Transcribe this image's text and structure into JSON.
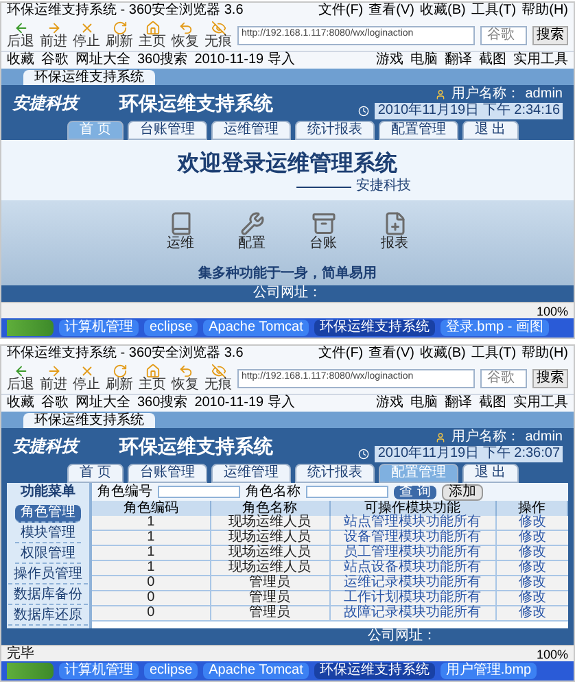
{
  "screens": [
    {
      "browser": {
        "title": "环保运维支持系统 - 360安全浏览器 3.6",
        "menu": [
          "文件(F)",
          "查看(V)",
          "收藏(B)",
          "工具(T)",
          "帮助(H)"
        ],
        "nav": [
          "后退",
          "前进",
          "停止",
          "刷新",
          "主页",
          "恢复",
          "无痕"
        ],
        "url": "http://192.168.1.117:8080/wx/loginaction",
        "search_placeholder": "谷歌",
        "search_button": "搜索",
        "favorites": [
          "收藏",
          "谷歌",
          "网址大全",
          "360搜索",
          "2010-11-19 导入"
        ],
        "tools": [
          "游戏",
          "电脑",
          "翻译",
          "截图",
          "实用工具"
        ],
        "tab": "环保运维支持系统"
      },
      "app": {
        "logo": "安捷科技",
        "title": "环保运维支持系统",
        "user_label": "用户名称：",
        "user": "admin",
        "datetime": "2010年11月19日 下午 2:34:16",
        "tabs": [
          {
            "label": "首 页",
            "selected": true
          },
          {
            "label": "台账管理",
            "selected": false
          },
          {
            "label": "运维管理",
            "selected": false
          },
          {
            "label": "统计报表",
            "selected": false
          },
          {
            "label": "配置管理",
            "selected": false
          },
          {
            "label": "退 出",
            "selected": false
          }
        ]
      },
      "content": {
        "kind": "welcome",
        "heading": "欢迎登录运维管理系统",
        "signature": "安捷科技",
        "modules": [
          "运维",
          "配置",
          "台账",
          "报表"
        ],
        "slogan": "集多种功能于一身，简单易用",
        "footer": "公司网址："
      },
      "status": {
        "zoom": "100%"
      },
      "taskbar": [
        {
          "label": "计算机管理",
          "selected": false
        },
        {
          "label": "eclipse",
          "selected": false
        },
        {
          "label": "Apache Tomcat",
          "selected": false
        },
        {
          "label": "环保运维支持系统",
          "selected": true
        },
        {
          "label": "登录.bmp - 画图",
          "selected": false
        }
      ]
    },
    {
      "browser": {
        "title": "环保运维支持系统 - 360安全浏览器 3.6",
        "menu": [
          "文件(F)",
          "查看(V)",
          "收藏(B)",
          "工具(T)",
          "帮助(H)"
        ],
        "nav": [
          "后退",
          "前进",
          "停止",
          "刷新",
          "主页",
          "恢复",
          "无痕"
        ],
        "url": "http://192.168.1.117:8080/wx/loginaction",
        "search_placeholder": "谷歌",
        "search_button": "搜索",
        "favorites": [
          "收藏",
          "谷歌",
          "网址大全",
          "360搜索",
          "2010-11-19 导入"
        ],
        "tools": [
          "游戏",
          "电脑",
          "翻译",
          "截图",
          "实用工具"
        ],
        "tab": "环保运维支持系统"
      },
      "app": {
        "logo": "安捷科技",
        "title": "环保运维支持系统",
        "user_label": "用户名称：",
        "user": "admin",
        "datetime": "2010年11月19日 下午 2:36:07",
        "tabs": [
          {
            "label": "首 页",
            "selected": false
          },
          {
            "label": "台账管理",
            "selected": false
          },
          {
            "label": "运维管理",
            "selected": false
          },
          {
            "label": "统计报表",
            "selected": false
          },
          {
            "label": "配置管理",
            "selected": true
          },
          {
            "label": "退 出",
            "selected": false
          }
        ]
      },
      "content": {
        "kind": "table",
        "menu_title": "功能菜单",
        "menu": [
          {
            "label": "角色管理",
            "selected": true
          },
          {
            "label": "模块管理",
            "selected": false
          },
          {
            "label": "权限管理",
            "selected": false
          },
          {
            "label": "操作员管理",
            "selected": false
          },
          {
            "label": "数据库备份",
            "selected": false
          },
          {
            "label": "数据库还原",
            "selected": false
          }
        ],
        "filters": [
          "角色编号",
          "角色名称"
        ],
        "search_button": "查 询",
        "add_button": "添加",
        "columns": [
          "角色编码",
          "角色名称",
          "可操作模块功能",
          "操作"
        ],
        "rows": [
          [
            "1",
            "现场运维人员",
            "站点管理模块功能所有",
            "修改"
          ],
          [
            "1",
            "现场运维人员",
            "设备管理模块功能所有",
            "修改"
          ],
          [
            "1",
            "现场运维人员",
            "员工管理模块功能所有",
            "修改"
          ],
          [
            "1",
            "现场运维人员",
            "站点设备模块功能所有",
            "修改"
          ],
          [
            "0",
            "管理员",
            "运维记录模块功能所有",
            "修改"
          ],
          [
            "0",
            "管理员",
            "工作计划模块功能所有",
            "修改"
          ],
          [
            "0",
            "管理员",
            "故障记录模块功能所有",
            "修改"
          ]
        ],
        "footer": "公司网址："
      },
      "status": {
        "left": "完毕",
        "zoom": "100%"
      },
      "taskbar": [
        {
          "label": "计算机管理",
          "selected": false
        },
        {
          "label": "eclipse",
          "selected": false
        },
        {
          "label": "Apache Tomcat",
          "selected": false
        },
        {
          "label": "环保运维支持系统",
          "selected": true
        },
        {
          "label": "用户管理.bmp",
          "selected": false
        }
      ]
    }
  ]
}
